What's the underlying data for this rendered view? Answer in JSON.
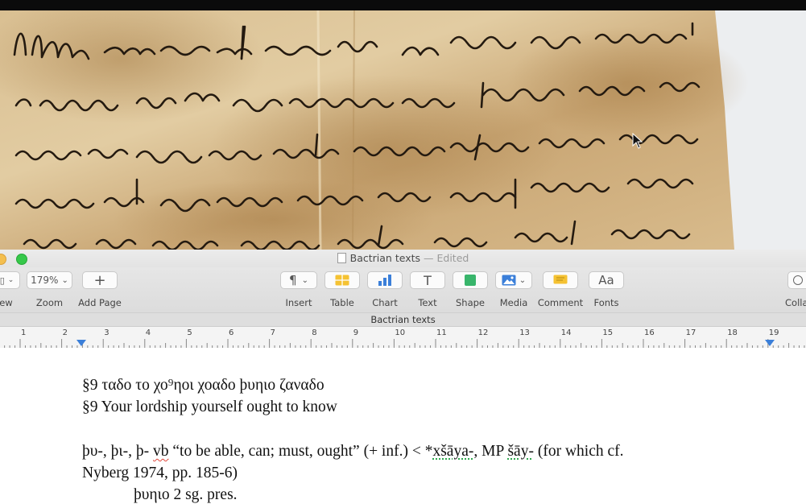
{
  "window": {
    "title": "Bactrian texts",
    "edited_label": "— Edited",
    "document_title": "Bactrian texts"
  },
  "toolbar": {
    "view_label": "iew",
    "zoom": {
      "value": "179%",
      "label": "Zoom"
    },
    "add_page": {
      "symbol": "+",
      "label": "Add Page"
    },
    "insert": {
      "symbol": "¶",
      "label": "Insert"
    },
    "table_label": "Table",
    "chart_label": "Chart",
    "text": {
      "symbol": "T",
      "label": "Text"
    },
    "shape_label": "Shape",
    "media_label": "Media",
    "comment_label": "Comment",
    "fonts": {
      "symbol": "Aa",
      "label": "Fonts"
    },
    "collab_label": "Colla"
  },
  "ruler": {
    "numbers": [
      "1",
      "2",
      "3",
      "4",
      "5",
      "6",
      "7",
      "8",
      "9",
      "10",
      "11",
      "12",
      "13",
      "14",
      "15",
      "16",
      "17",
      "18",
      "19"
    ]
  },
  "document": {
    "line1": "§9 ταδο το χο⁹ηοι χοαδο þυηιο ζαναδο",
    "line2": "§9 Your lordship yourself ought to know",
    "entry": {
      "head_start": "þυ-, þι-, þ- ",
      "head_vb": "vb",
      "head_mid": " “to be able, can; must, ought” (+ inf.) < *",
      "head_xsaya": "xšāya-",
      "head_mid2": ", MP ",
      "head_say": "šāy-",
      "head_end": " (for which cf.",
      "line2": "Nyberg 1974, pp. 185-6)",
      "line3": "þυηιο 2 sg. pres."
    }
  },
  "colors": {
    "accent_blue": "#3b7fd9",
    "traffic_green": "#36c84a",
    "traffic_yellow": "#f4bf4f",
    "spell_red": "#e0463a",
    "grammar_green": "#2fa84f"
  },
  "icons": [
    "view-icon",
    "chevron-down-icon",
    "plus-icon",
    "paragraph-icon",
    "table-icon",
    "chart-icon",
    "text-icon",
    "shape-icon",
    "media-icon",
    "comment-icon",
    "fonts-icon",
    "mouse-pointer-icon"
  ]
}
